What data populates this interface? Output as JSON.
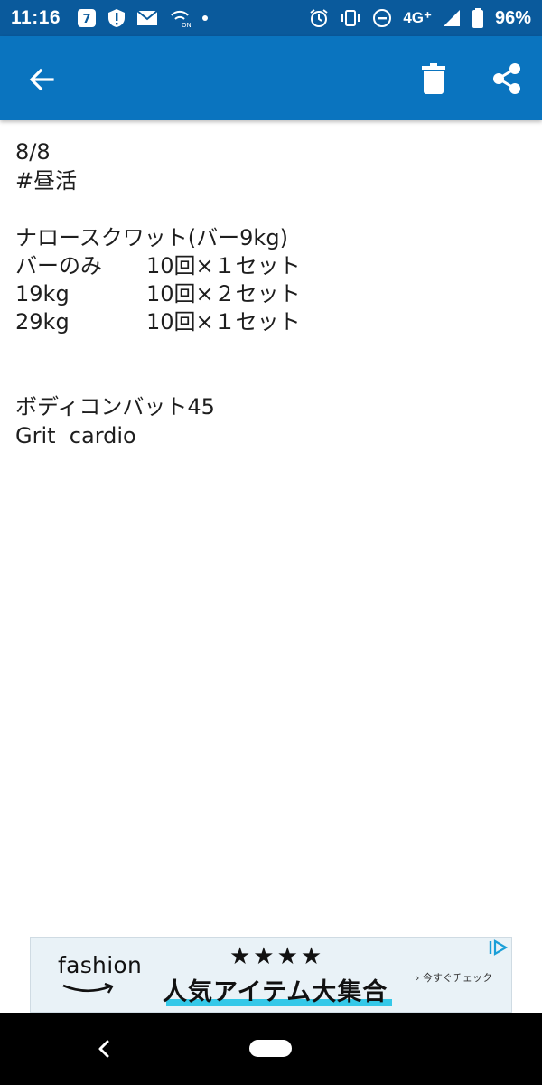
{
  "status_bar": {
    "time": "11:16",
    "network": "4G⁺",
    "battery_percent": "96%"
  },
  "app_bar": {
    "background_color": "#0a74bf",
    "icons": [
      "back-arrow-icon",
      "trash-icon",
      "share-icon"
    ]
  },
  "memo": {
    "date": "8/8",
    "hashtag": "#昼活",
    "exercise_title": "ナロースクワット(バー9kg)",
    "sets": [
      {
        "weight": "バーのみ",
        "reps": "10回×１セット"
      },
      {
        "weight": "19kg",
        "reps": "10回×２セット"
      },
      {
        "weight": "29kg",
        "reps": "10回×１セット"
      }
    ],
    "class_name": "ボディコンバット45",
    "class_extra": "Grit  cardio"
  },
  "ad": {
    "brand": "fashion",
    "stars": "★★★★",
    "headline": "人気アイテム大集合",
    "cta": "› 今すぐチェック",
    "accent_color": "#35c8e8"
  }
}
